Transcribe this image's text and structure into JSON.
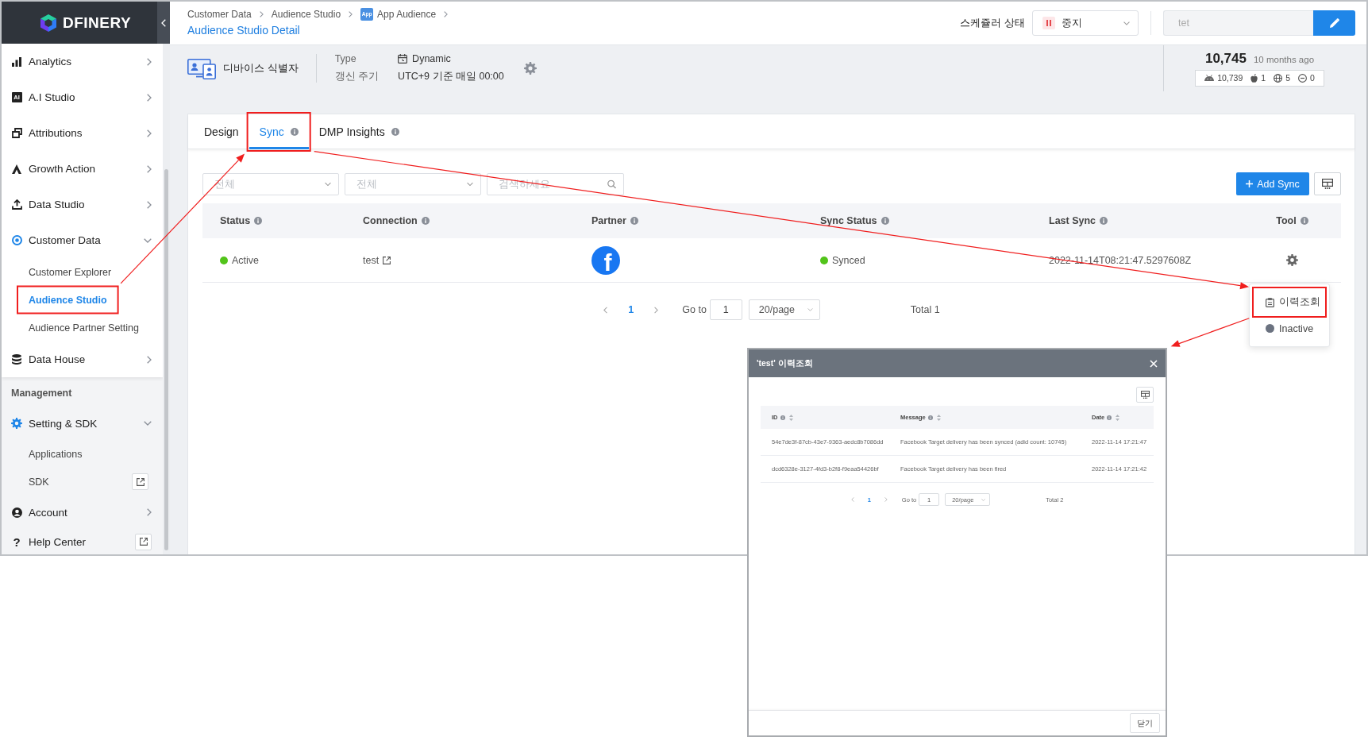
{
  "sidebar": {
    "logo": "DFINERY",
    "menu": [
      {
        "label": "Analytics",
        "kind": "group",
        "expanded": false
      },
      {
        "label": "A.I Studio",
        "icon_text": "AI",
        "kind": "group",
        "expanded": false
      },
      {
        "label": "Attributions",
        "kind": "group",
        "expanded": false
      },
      {
        "label": "Growth Action",
        "kind": "group",
        "expanded": false
      },
      {
        "label": "Data Studio",
        "kind": "group",
        "expanded": false
      },
      {
        "label": "Customer Data",
        "kind": "group",
        "expanded": true,
        "children": [
          {
            "label": "Customer Explorer",
            "selected": false,
            "annotated": false,
            "external": false
          },
          {
            "label": "Audience Studio",
            "selected": true,
            "annotated": true,
            "external": false
          },
          {
            "label": "Audience Partner Setting",
            "selected": false,
            "annotated": false,
            "external": false
          }
        ]
      },
      {
        "label": "Data House",
        "kind": "group",
        "expanded": false
      }
    ],
    "management": {
      "title": "Management",
      "menu": [
        {
          "label": "Setting & SDK",
          "kind": "group",
          "expanded": true,
          "children": [
            {
              "label": "Applications",
              "selected": false,
              "annotated": false,
              "external": false
            },
            {
              "label": "SDK",
              "selected": false,
              "annotated": false,
              "external": true
            }
          ]
        },
        {
          "label": "Account",
          "kind": "group",
          "expanded": false
        },
        {
          "label": "Help Center",
          "icon_text": "?",
          "kind": "link"
        }
      ]
    }
  },
  "header": {
    "breadcrumb": [
      {
        "label": "Customer Data"
      },
      {
        "label": "Audience Studio"
      },
      {
        "label": "App Audience",
        "badge": "App"
      }
    ],
    "title": "Audience Studio Detail",
    "scheduler": {
      "label": "스케쥴러 상태",
      "kind": "paused",
      "value": "중지"
    },
    "name_field": {
      "value": "tet",
      "disabled": true
    }
  },
  "audience_info": {
    "identifier": "디바이스 식별자",
    "fields": [
      {
        "kind": "type",
        "label": "Type",
        "value": "Dynamic"
      },
      {
        "kind": "schedule",
        "label": "갱신 주기",
        "value": "UTC+9 기준 매일 00:00"
      }
    ],
    "count": "10,745",
    "updated": "10 months ago",
    "platform_counts": [
      {
        "kind": "android",
        "count": "10,739"
      },
      {
        "kind": "ios",
        "count": "1"
      },
      {
        "kind": "web",
        "count": "5"
      },
      {
        "kind": "unknown",
        "count": "0"
      }
    ]
  },
  "sync_panel": {
    "tabs": [
      {
        "label": "Design",
        "selected": false,
        "info": false,
        "annotated": false
      },
      {
        "label": "Sync",
        "selected": true,
        "info": true,
        "annotated": true
      },
      {
        "label": "DMP Insights",
        "selected": false,
        "info": true,
        "annotated": false
      }
    ],
    "filters": [
      {
        "kind": "select",
        "placeholder": "전체"
      },
      {
        "kind": "select",
        "placeholder": "전체"
      },
      {
        "kind": "search",
        "placeholder": "검색하세요"
      }
    ],
    "add_button": "Add Sync",
    "table": {
      "columns": [
        {
          "label": "Status",
          "info": true
        },
        {
          "label": "Connection",
          "info": true
        },
        {
          "label": "Partner",
          "info": true
        },
        {
          "label": "Sync Status",
          "info": true
        },
        {
          "label": "Last Sync",
          "info": true
        },
        {
          "label": "Tool",
          "info": true
        }
      ],
      "rows": [
        {
          "status": {
            "label": "Active",
            "color": "#52c41a"
          },
          "connection": {
            "label": "test",
            "external": true
          },
          "partner": {
            "logo": "f"
          },
          "sync_status": {
            "label": "Synced",
            "color": "#52c41a"
          },
          "last_sync": "2022-11-14T08:21:47.5297608Z",
          "tool_menu": {
            "open": true,
            "items": [
              {
                "kind": "history",
                "label": "이력조회",
                "annotated": true
              },
              {
                "kind": "status",
                "label": "Inactive",
                "annotated": false
              }
            ]
          }
        }
      ]
    },
    "pagination": {
      "pages": [
        {
          "label": "1",
          "selected": true
        }
      ],
      "goto_label": "Go to",
      "goto_value": "1",
      "page_size": "20/page",
      "total": "Total 1"
    }
  },
  "history_dialog": {
    "title": "'test' 이력조회",
    "columns": [
      {
        "label": "ID",
        "info": true,
        "sortable": true
      },
      {
        "label": "Message",
        "info": true,
        "sortable": true
      },
      {
        "label": "Date",
        "info": true,
        "sortable": true
      }
    ],
    "rows": [
      {
        "id": "54e7de3f-87cb-43e7-9363-aedc8b7086dd",
        "message": "Facebook Target delivery has been synced (adid count: 10745)",
        "date": "2022-11-14 17:21:47"
      },
      {
        "id": "dcd6328e-3127-4fd3-b2f8-f9eaa54426bf",
        "message": "Facebook Target delivery has been fired",
        "date": "2022-11-14 17:21:42"
      }
    ],
    "pagination": {
      "pages": [
        {
          "label": "1",
          "selected": true
        }
      ],
      "goto_label": "Go to",
      "goto_value": "1",
      "page_size": "20/page",
      "total": "Total 2"
    },
    "close_button": "닫기"
  }
}
